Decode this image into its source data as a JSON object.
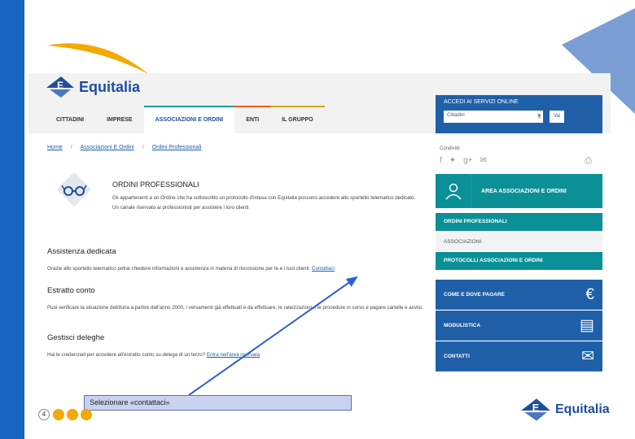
{
  "brand": {
    "name": "Equitalia"
  },
  "nav": {
    "items": [
      "CITTADINI",
      "IMPRESE",
      "ASSOCIAZIONI E ORDINI",
      "ENTI",
      "IL GRUPPO"
    ]
  },
  "access": {
    "title": "ACCEDI AI SERVIZI ONLINE",
    "select_value": "Cittadini",
    "button": "Vai"
  },
  "breadcrumb": {
    "items": [
      "Home",
      "Associazioni E Ordini",
      "Ordini Professionali"
    ],
    "separator": "/"
  },
  "ordini": {
    "title": "ORDINI PROFESSIONALI",
    "description": "Gli appartenenti a un Ordine che ha sottoscritto un protocollo d'intesa con Equitalia possono accedere allo sportello telematico dedicato. Un canale riservato ai professionisti per assistere i loro clienti"
  },
  "sections": [
    {
      "title": "Assistenza dedicata",
      "text": "Grazie allo sportello telematico potrai chiedere informazioni e assistenza in materia di riscossione per te e i tuoi clienti.",
      "link": "Contattaci"
    },
    {
      "title": "Estratto conto",
      "text": "Puoi verificare la situazione debitoria a partire dall'anno 2000, i versamenti già effettuati e da effettuare, le rateizzazioni e le procedure in corso e pagare cartelle e avvisi.",
      "link": ""
    },
    {
      "title": "Gestisci deleghe",
      "text": "Hai le credenziali per accedere all'estratto conto su delega di un terzo?",
      "link": "Entra nell'area riservata"
    }
  ],
  "sidebar": {
    "share_label": "Condividi",
    "area_label": "AREA ASSOCIAZIONI E ORDINI",
    "items": [
      "ORDINI PROFESSIONALI",
      "ASSOCIAZIONI",
      "PROTOCOLLI ASSOCIAZIONI E ORDINI"
    ],
    "blue_items": [
      "COME E DOVE PAGARE",
      "MODULISTICA",
      "CONTATTI"
    ]
  },
  "caption": {
    "text": "Selezionare «contattaci»"
  },
  "page": {
    "number": "4"
  },
  "colors": {
    "brand_blue": "#1f5fa8",
    "teal": "#0a9096",
    "orange": "#f2a900",
    "caption_bg": "#c9d3ef"
  }
}
